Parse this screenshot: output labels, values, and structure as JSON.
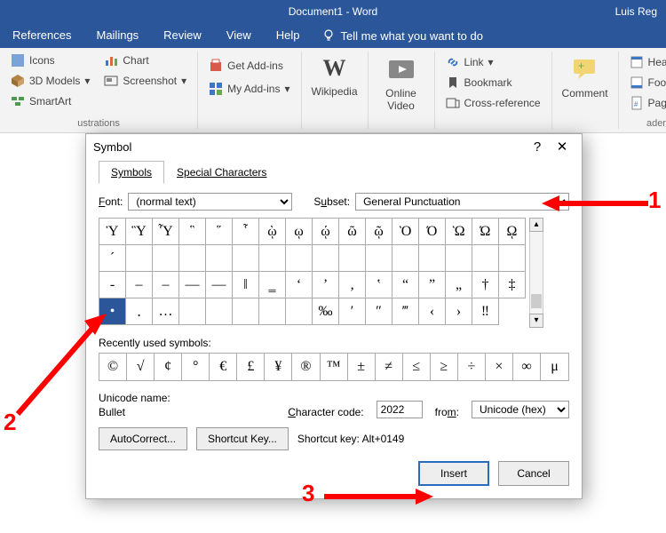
{
  "titlebar": {
    "title": "Document1 - Word",
    "user": "Luis Reg"
  },
  "menubar": {
    "tabs": [
      "References",
      "Mailings",
      "Review",
      "View",
      "Help"
    ],
    "tell": "Tell me what you want to do"
  },
  "ribbon": {
    "group_illustrations": {
      "label": "ustrations",
      "items": [
        "Icons",
        "3D Models",
        "SmartArt",
        "Chart",
        "Screenshot"
      ]
    },
    "group_addins": {
      "get": "Get Add-ins",
      "my": "My Add-ins"
    },
    "wikipedia": "Wikipedia",
    "online_video": "Online\nVideo",
    "group_links": {
      "link": "Link",
      "bookmark": "Bookmark",
      "crossref": "Cross-reference"
    },
    "comment": "Comment",
    "group_headerfooter": {
      "label": "ader & Footer",
      "header": "Header",
      "footer": "Footer",
      "page": "Page Number"
    }
  },
  "dialog": {
    "title": "Symbol",
    "tabs": {
      "symbols": "Symbols",
      "special": "Special Characters"
    },
    "font_label": "Font:",
    "font_value": "(normal text)",
    "subset_label": "Subset:",
    "subset_value": "General Punctuation",
    "grid": [
      [
        "Ὑ",
        "Ὓ",
        "Ὗ",
        "῝",
        "῞",
        "῟",
        "ῲ",
        "ῳ",
        "ῴ",
        "ῶ",
        "ῷ",
        "Ὸ",
        "Ό",
        "Ὼ",
        "Ώ",
        "ῼ"
      ],
      [
        "´",
        "",
        "",
        "",
        "",
        "",
        "",
        "",
        "",
        "",
        "",
        "",
        "",
        "",
        "",
        ""
      ],
      [
        "‐",
        "‒",
        "–",
        "—",
        "―",
        "‖",
        "‗",
        "‘",
        "’",
        "‚",
        "‛",
        "“",
        "”",
        "„",
        "†",
        "‡"
      ],
      [
        "•",
        "․",
        "…",
        "",
        "",
        "",
        "",
        "",
        "‰",
        "′",
        "″",
        "‴",
        "‹",
        "›",
        "‼"
      ]
    ],
    "selected": {
      "row": 3,
      "col": 0
    },
    "recent_label": "Recently used symbols:",
    "recent": [
      "©",
      "√",
      "¢",
      "°",
      "€",
      "£",
      "¥",
      "®",
      "™",
      "±",
      "≠",
      "≤",
      "≥",
      "÷",
      "×",
      "∞",
      "μ"
    ],
    "unicode_name_label": "Unicode name:",
    "unicode_name": "Bullet",
    "charcode_label": "Character code:",
    "charcode": "2022",
    "from_label": "from:",
    "from_value": "Unicode (hex)",
    "autocorrect": "AutoCorrect...",
    "shortcutkey_btn": "Shortcut Key...",
    "shortcut_label": "Shortcut key: Alt+0149",
    "insert": "Insert",
    "cancel": "Cancel"
  },
  "annotations": {
    "n1": "1",
    "n2": "2",
    "n3": "3"
  }
}
